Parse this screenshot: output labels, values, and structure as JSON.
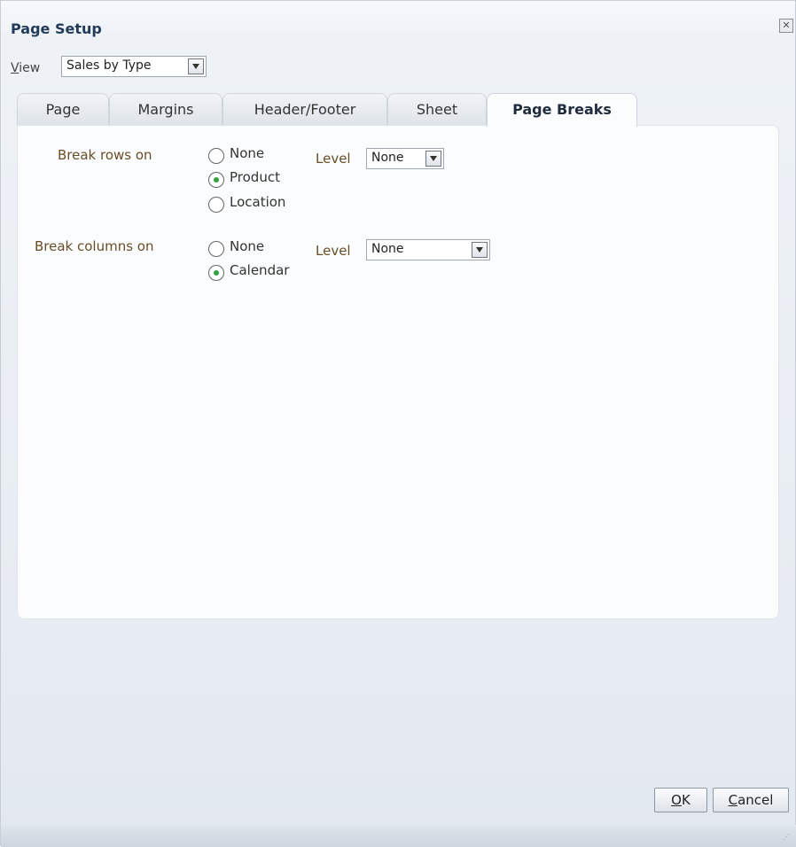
{
  "dialog": {
    "title": "Page Setup",
    "close_icon": "close-icon"
  },
  "view": {
    "label_prefix": "V",
    "label_rest": "iew",
    "selected": "Sales by Type"
  },
  "tabs": [
    {
      "label": "Page",
      "active": false
    },
    {
      "label": "Margins",
      "active": false
    },
    {
      "label": "Header/Footer",
      "active": false
    },
    {
      "label": "Sheet",
      "active": false
    },
    {
      "label": "Page Breaks",
      "active": true
    }
  ],
  "rows": {
    "label": "Break rows on",
    "options": [
      {
        "label": "None",
        "checked": false
      },
      {
        "label": "Product",
        "checked": true
      },
      {
        "label": "Location",
        "checked": false
      }
    ],
    "level_label": "Level",
    "level_value": "None"
  },
  "columns": {
    "label": "Break columns on",
    "options": [
      {
        "label": "None",
        "checked": false
      },
      {
        "label": "Calendar",
        "checked": true
      }
    ],
    "level_label": "Level",
    "level_value": "None"
  },
  "buttons": {
    "ok_prefix": "O",
    "ok_rest": "K",
    "cancel_prefix": "C",
    "cancel_rest": "ancel"
  },
  "colors": {
    "title": "#233b5a",
    "label_brown": "#6a4d26",
    "radio_checked": "#2fa23a"
  }
}
